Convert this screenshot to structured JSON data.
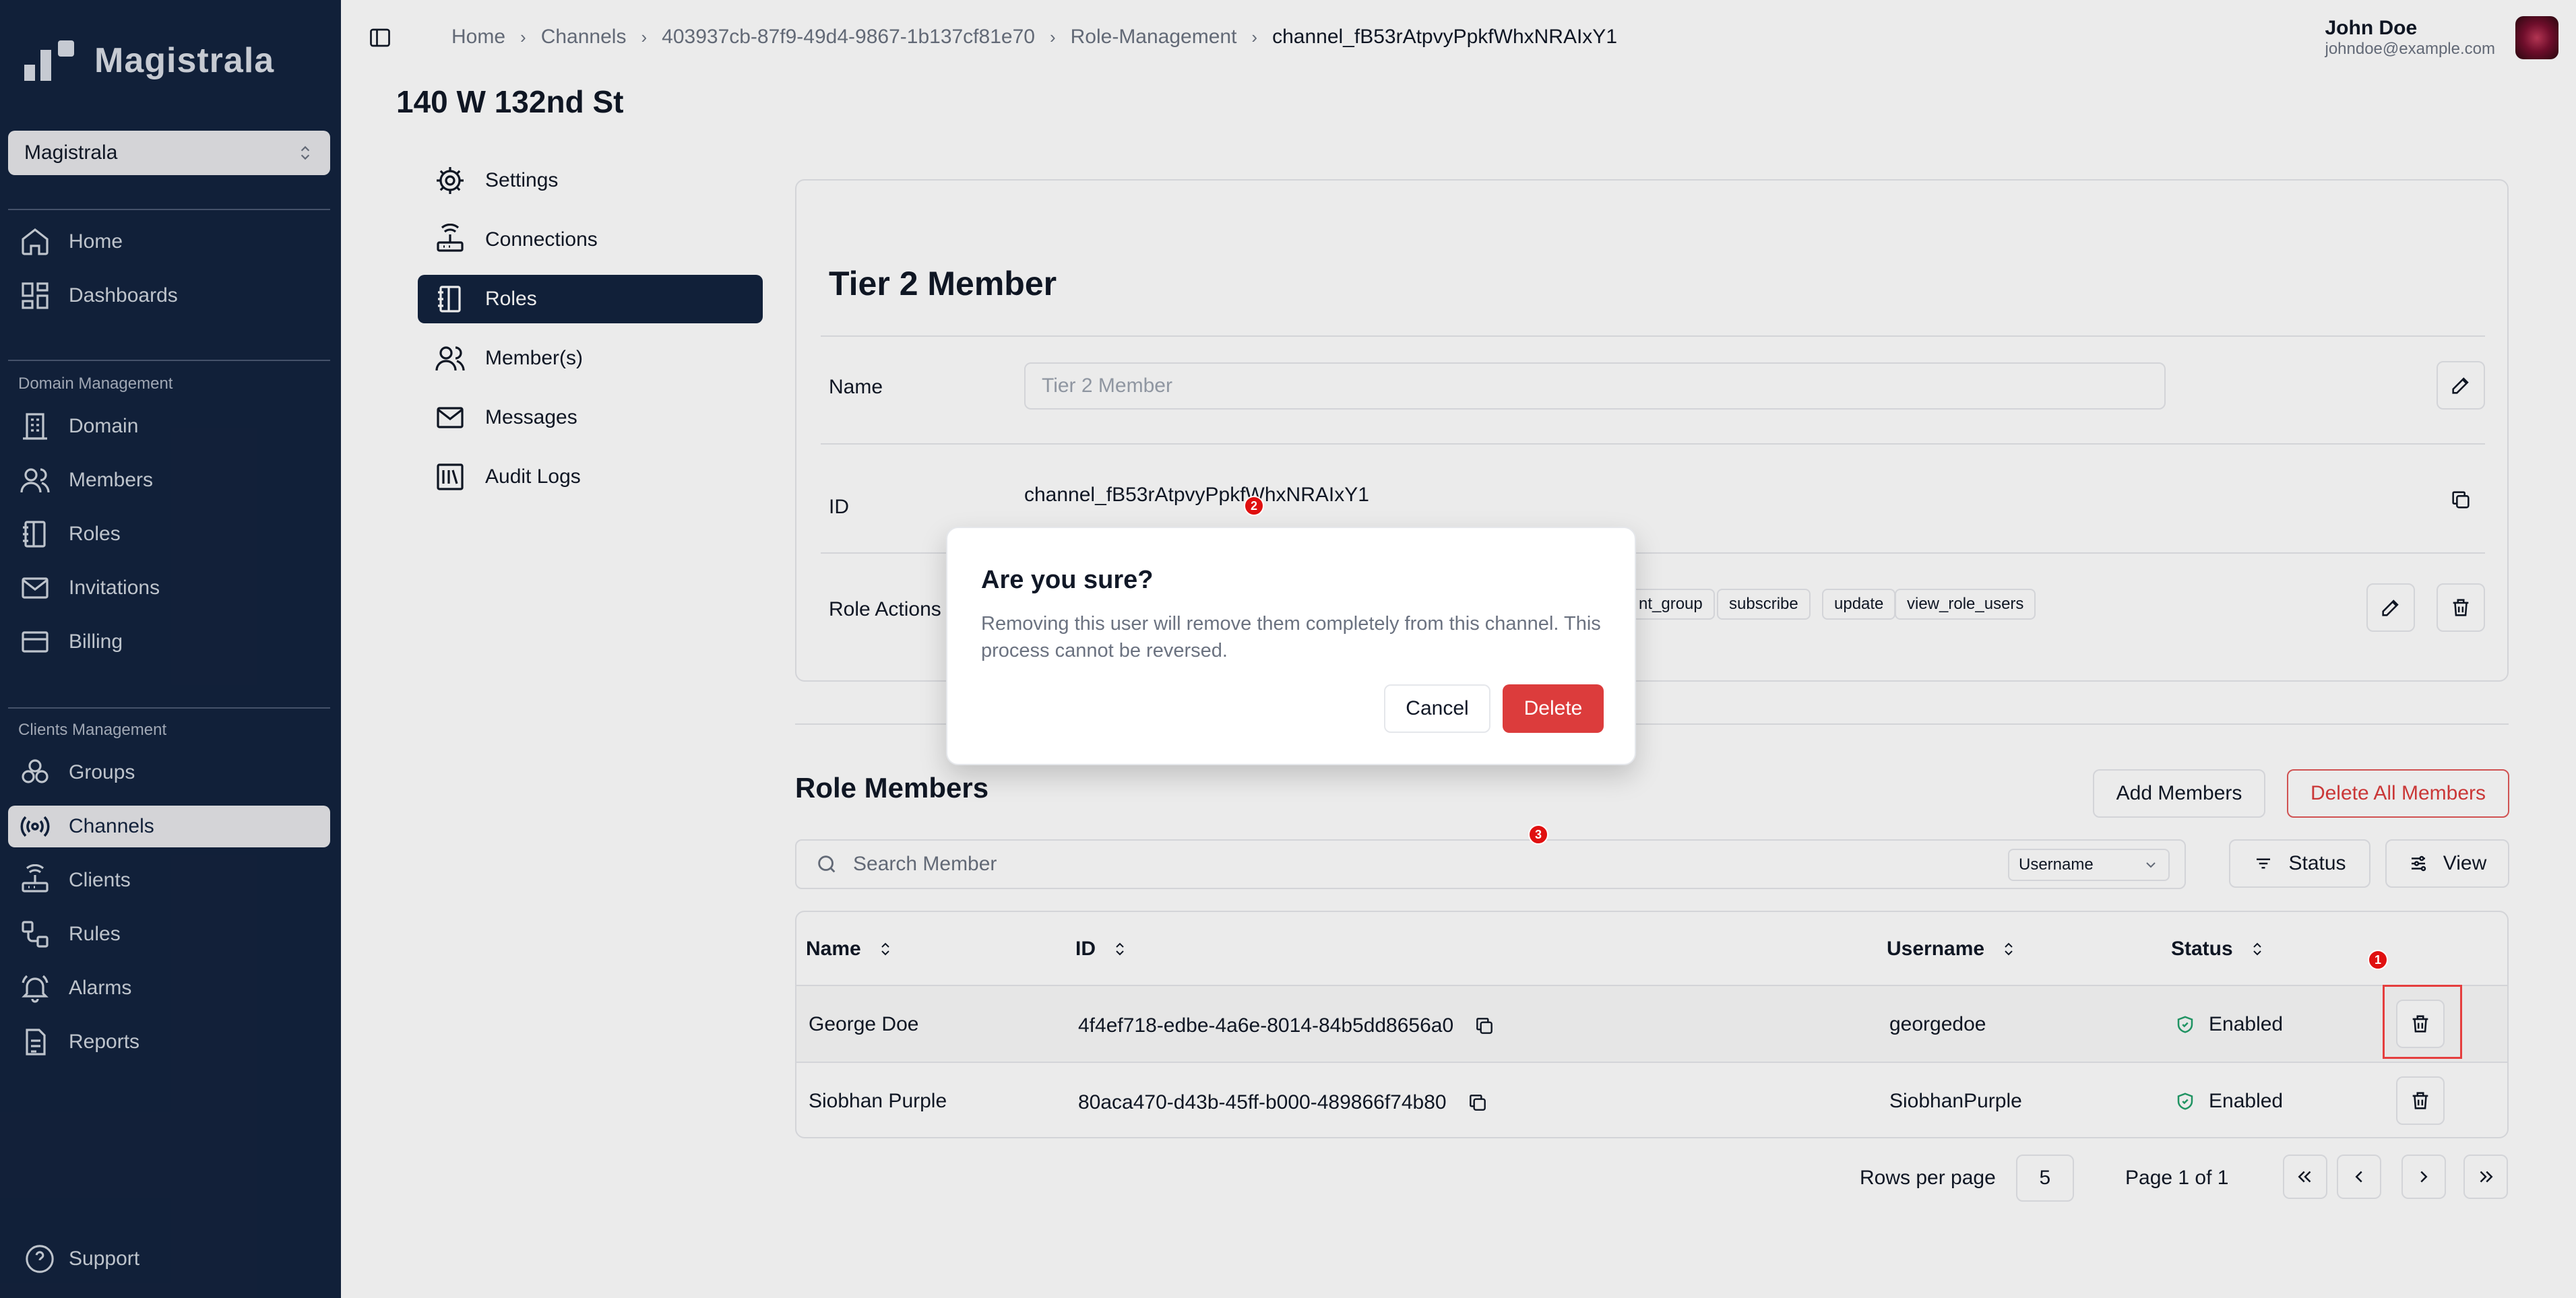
{
  "sidebar": {
    "brand": "Magistrala",
    "domain_select": "Magistrala",
    "items_top": [
      {
        "label": "Home",
        "icon": "home-icon"
      },
      {
        "label": "Dashboards",
        "icon": "dashboard-icon"
      }
    ],
    "section_domain": "Domain Management",
    "items_domain": [
      {
        "label": "Domain",
        "icon": "building-icon"
      },
      {
        "label": "Members",
        "icon": "users-icon"
      },
      {
        "label": "Roles",
        "icon": "notebook-icon"
      },
      {
        "label": "Invitations",
        "icon": "mail-icon"
      },
      {
        "label": "Billing",
        "icon": "credit-card-icon"
      }
    ],
    "section_clients": "Clients Management",
    "items_clients": [
      {
        "label": "Groups",
        "icon": "groups-icon"
      },
      {
        "label": "Channels",
        "icon": "radio-icon",
        "active": true
      },
      {
        "label": "Clients",
        "icon": "router-icon"
      },
      {
        "label": "Rules",
        "icon": "workflow-icon"
      },
      {
        "label": "Alarms",
        "icon": "bell-icon"
      },
      {
        "label": "Reports",
        "icon": "report-icon"
      }
    ],
    "support": "Support"
  },
  "header": {
    "breadcrumbs": [
      "Home",
      "Channels",
      "403937cb-87f9-49d4-9867-1b137cf81e70",
      "Role-Management",
      "channel_fB53rAtpvyPpkfWhxNRAIxY1"
    ],
    "user_name": "John Doe",
    "user_email": "johndoe@example.com"
  },
  "page_title": "140 W 132nd St",
  "subnav": [
    {
      "label": "Settings",
      "icon": "gear-icon"
    },
    {
      "label": "Connections",
      "icon": "router-icon"
    },
    {
      "label": "Roles",
      "icon": "notebook-icon",
      "active": true
    },
    {
      "label": "Member(s)",
      "icon": "users-icon"
    },
    {
      "label": "Messages",
      "icon": "mail-icon"
    },
    {
      "label": "Audit Logs",
      "icon": "library-icon"
    }
  ],
  "role": {
    "title": "Tier 2 Member",
    "name_label": "Name",
    "name_placeholder": "Tier 2 Member",
    "id_label": "ID",
    "id_value": "channel_fB53rAtpvyPpkfWhxNRAIxY1",
    "actions_label": "Role Actions",
    "actions": [
      "nt_group",
      "subscribe",
      "update",
      "view_role_users"
    ]
  },
  "members": {
    "title": "Role Members",
    "add_button": "Add Members",
    "delete_all_button": "Delete All Members",
    "search_placeholder": "Search Member",
    "filter_value": "Username",
    "status_button": "Status",
    "view_button": "View",
    "columns": [
      "Name",
      "ID",
      "Username",
      "Status"
    ],
    "rows": [
      {
        "name": "George Doe",
        "id": "4f4ef718-edbe-4a6e-8014-84b5dd8656a0",
        "username": "georgedoe",
        "status": "Enabled"
      },
      {
        "name": "Siobhan Purple",
        "id": "80aca470-d43b-45ff-b000-489866f74b80",
        "username": "SiobhanPurple",
        "status": "Enabled"
      }
    ],
    "rows_per_page_label": "Rows per page",
    "rows_per_page": "5",
    "page_info": "Page 1 of 1"
  },
  "dialog": {
    "title": "Are you sure?",
    "description": "Removing this user will remove them completely from this channel. This process cannot be reversed.",
    "cancel": "Cancel",
    "delete": "Delete"
  },
  "markers": [
    "1",
    "2",
    "3"
  ],
  "colors": {
    "sidebar_bg": "#13233e",
    "danger": "#dc3c3c",
    "success": "#22a06b"
  }
}
